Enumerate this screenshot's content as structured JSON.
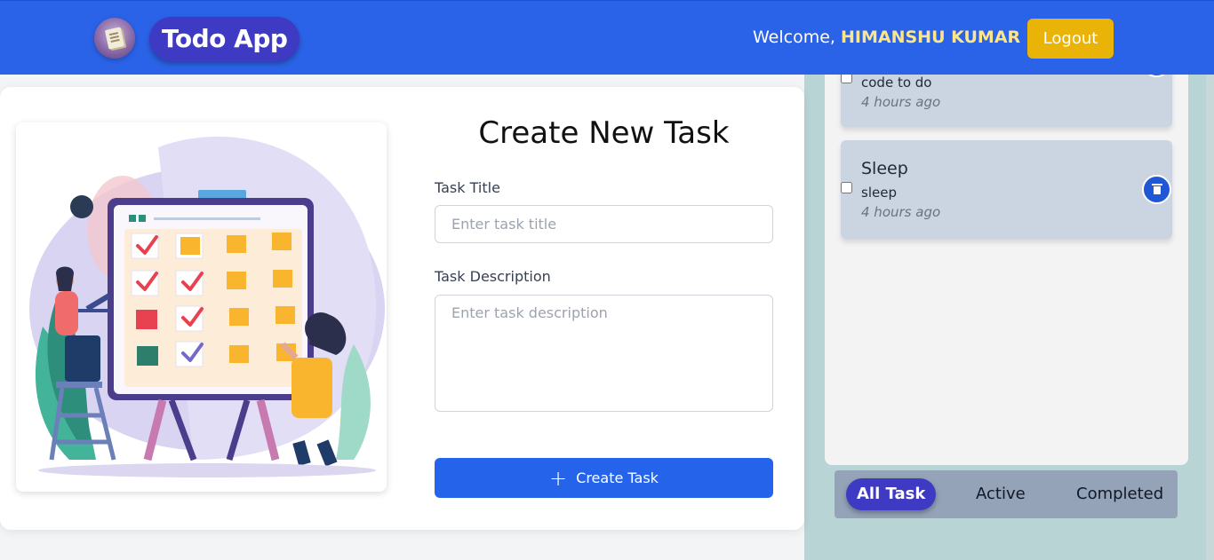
{
  "header": {
    "brand": "Todo App",
    "welcome_prefix": "Welcome,",
    "username": "HIMANSHU KUMAR",
    "logout_label": "Logout"
  },
  "form": {
    "title": "Create New Task",
    "task_title_label": "Task Title",
    "task_title_placeholder": "Enter task title",
    "task_description_label": "Task Description",
    "task_description_placeholder": "Enter task description",
    "create_label": "Create Task"
  },
  "tasks": [
    {
      "description": "code to do",
      "time": "4 hours ago"
    },
    {
      "title": "Sleep",
      "description": "sleep",
      "time": "4 hours ago"
    }
  ],
  "filters": {
    "all": "All Task",
    "active": "Active",
    "completed": "Completed"
  },
  "colors": {
    "header": "#2b63e8",
    "brand_pill": "#3f3ac4",
    "logout": "#eab308",
    "primary_button": "#2563eb",
    "card": "#cbd5e1"
  }
}
